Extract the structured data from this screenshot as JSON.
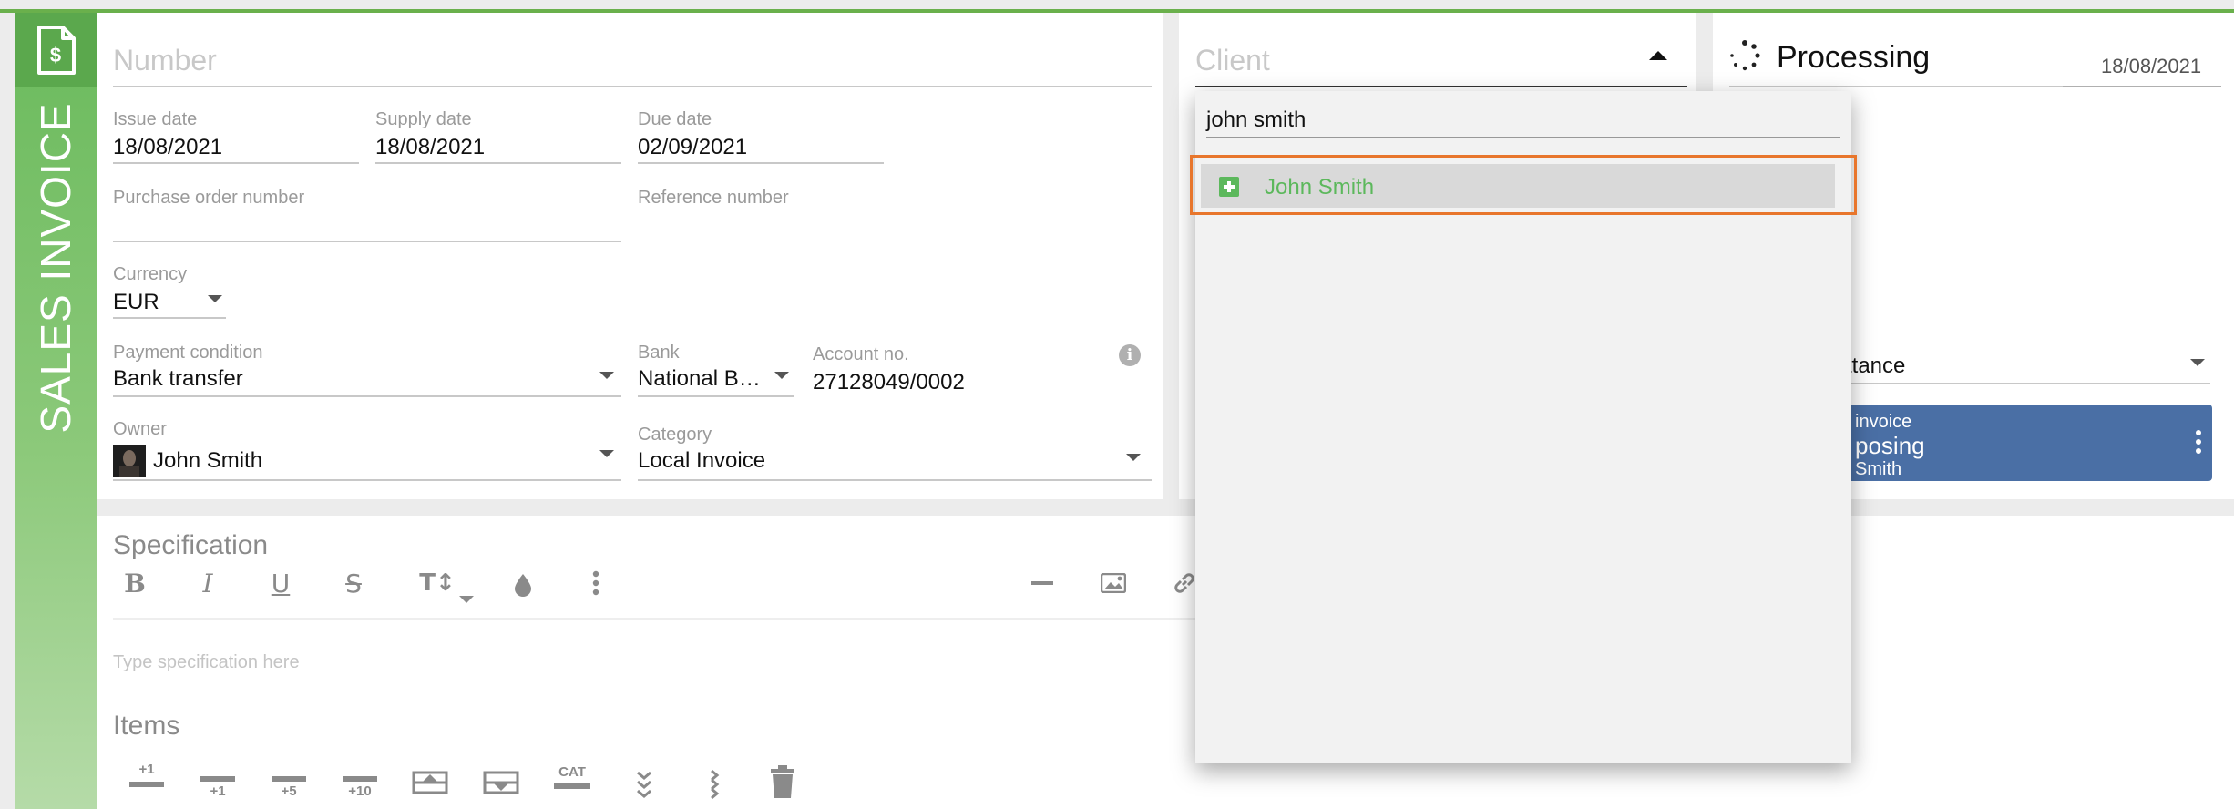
{
  "sidebar": {
    "title": "SALES INVOICE"
  },
  "form": {
    "number_placeholder": "Number",
    "issue_date": {
      "label": "Issue date",
      "value": "18/08/2021"
    },
    "supply_date": {
      "label": "Supply date",
      "value": "18/08/2021"
    },
    "due_date": {
      "label": "Due date",
      "value": "02/09/2021"
    },
    "po_number": {
      "label": "Purchase order number",
      "value": ""
    },
    "reference_number": {
      "label": "Reference number",
      "value": ""
    },
    "currency": {
      "label": "Currency",
      "value": "EUR"
    },
    "payment_condition": {
      "label": "Payment condition",
      "value": "Bank transfer"
    },
    "bank": {
      "label": "Bank",
      "value": "National B…"
    },
    "account_no": {
      "label": "Account no.",
      "value": "27128049/0002"
    },
    "owner": {
      "label": "Owner",
      "value": "John Smith"
    },
    "category": {
      "label": "Category",
      "value": "Local Invoice"
    }
  },
  "client": {
    "placeholder": "Client",
    "search_value": "john smith",
    "options": [
      {
        "label": "John Smith",
        "icon": "add-square-icon"
      }
    ]
  },
  "status": {
    "title": "Processing",
    "date": "18/08/2021",
    "partial_select_value": "ttance",
    "card_line1": "invoice",
    "card_line2": "posing",
    "card_line3": "Smith"
  },
  "specification": {
    "title": "Specification",
    "placeholder": "Type specification here"
  },
  "items": {
    "title": "Items",
    "toolbar": {
      "plus1_top": "+1",
      "plus1": "+1",
      "plus5": "+5",
      "plus10": "+10",
      "cat": "CAT"
    }
  },
  "colors": {
    "accent_green": "#6ab04c",
    "client_option_green": "#5cb85c",
    "card_blue": "#4a6fa5",
    "highlight_orange": "#e8762c"
  }
}
